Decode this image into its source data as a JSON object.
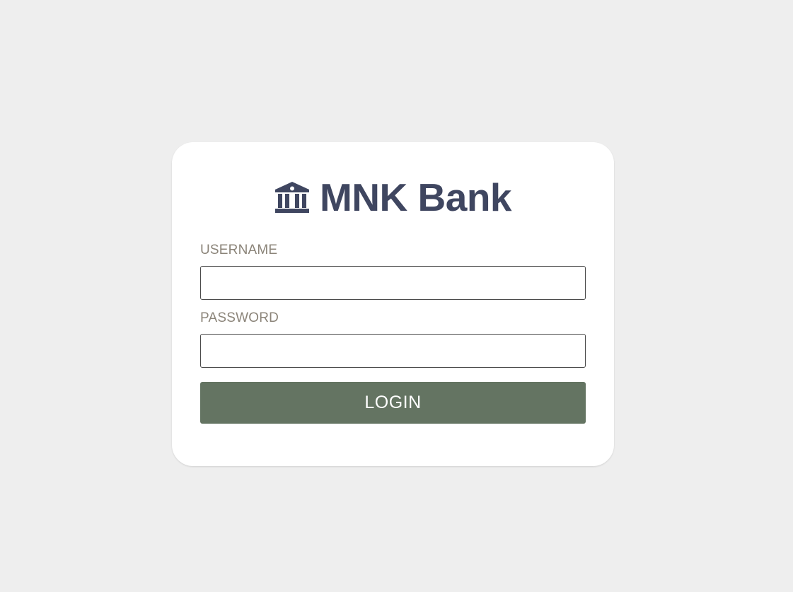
{
  "brand": {
    "icon": "bank-icon",
    "title": "MNK Bank",
    "color": "#3f4660"
  },
  "form": {
    "username_label": "USERNAME",
    "username_value": "",
    "password_label": "PASSWORD",
    "password_value": "",
    "login_label": "LOGIN"
  },
  "colors": {
    "background": "#eeeeee",
    "card": "#ffffff",
    "button": "#647462",
    "label": "#8b8479"
  }
}
